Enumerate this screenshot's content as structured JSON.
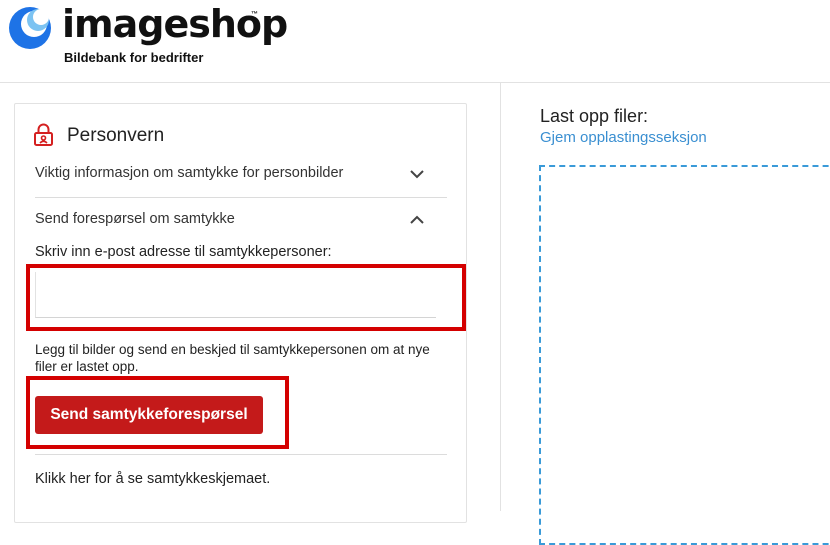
{
  "header": {
    "logo_word": "imageshop",
    "logo_tm": "™",
    "logo_tagline": "Bildebank for bedrifter"
  },
  "privacy": {
    "title": "Personvern",
    "accordion": [
      {
        "label": "Viktig informasjon om samtykke for personbilder",
        "expanded": false
      },
      {
        "label": "Send forespørsel om samtykke",
        "expanded": true
      }
    ],
    "email_label": "Skriv inn e-post adresse til samtykkepersoner:",
    "email_value": "",
    "help_text": "Legg til bilder og send en beskjed til samtykkepersonen om at nye filer er lastet opp.",
    "send_button": "Send samtykkeforespørsel",
    "form_link": "Klikk her for å se samtykkeskjemaet."
  },
  "upload": {
    "title": "Last opp filer:",
    "hide_link": "Gjem opplastingsseksjon"
  },
  "colors": {
    "accent_red": "#c41a1a",
    "highlight_red": "#d40000",
    "link_blue": "#3a8fd1",
    "dropzone_blue": "#3a9ad8",
    "logo_blue": "#1e73e6"
  }
}
